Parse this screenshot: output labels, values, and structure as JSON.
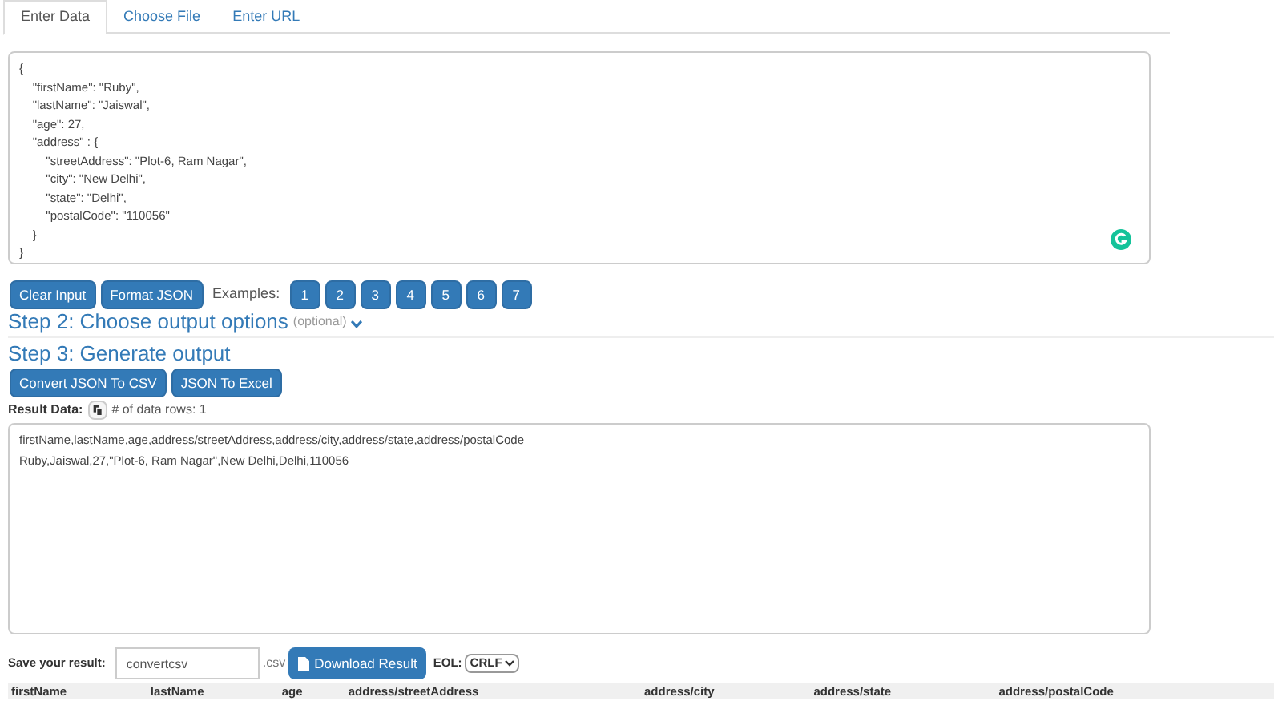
{
  "tabs": [
    {
      "label": "Enter Data",
      "selected": true
    },
    {
      "label": "Choose File",
      "selected": false
    },
    {
      "label": "Enter URL",
      "selected": false
    }
  ],
  "input": {
    "value": "{\n    \"firstName\": \"Ruby\",\n    \"lastName\": \"Jaiswal\",\n    \"age\": 27,\n    \"address\" : {\n        \"streetAddress\": \"Plot-6, Ram Nagar\",\n        \"city\": \"New Delhi\",\n        \"state\": \"Delhi\",\n        \"postalCode\": \"110056\"\n    }\n}"
  },
  "input_buttons": [
    "Clear Input",
    "Format JSON"
  ],
  "examples_label": "Examples:",
  "examples": [
    "1",
    "2",
    "3",
    "4",
    "5",
    "6",
    "7"
  ],
  "step2": {
    "title": "Step 2: Choose output options",
    "note": "(optional)"
  },
  "step3": {
    "title": "Step 3: Generate output"
  },
  "output_buttons": [
    "Convert JSON To CSV",
    "JSON To Excel"
  ],
  "result_label": "Result Data:",
  "row_count": "# of data rows: 1",
  "result": {
    "value": "firstName,lastName,age,address/streetAddress,address/city,address/state,address/postalCode\nRuby,Jaiswal,27,\"Plot-6, Ram Nagar\",New Delhi,Delhi,110056"
  },
  "save_label": "Save your result:",
  "filename": {
    "value": "convertcsv"
  },
  "extension": ".csv",
  "download_button": "Download Result",
  "eol_label": "EOL:",
  "eol_value": "CRLF",
  "table": {
    "columns": [
      "firstName",
      "lastName",
      "age",
      "address/streetAddress",
      "address/city",
      "address/state",
      "address/postalCode"
    ]
  }
}
